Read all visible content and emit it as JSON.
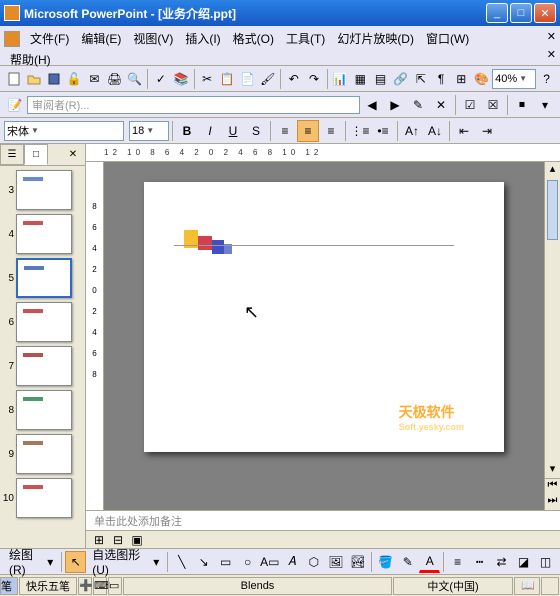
{
  "titlebar": {
    "title": "Microsoft PowerPoint - [业务介绍.ppt]"
  },
  "menu": {
    "file": "文件(F)",
    "edit": "编辑(E)",
    "view": "视图(V)",
    "insert": "插入(I)",
    "format": "格式(O)",
    "tools": "工具(T)",
    "slideshow": "幻灯片放映(D)",
    "window": "窗口(W)",
    "help": "帮助(H)"
  },
  "toolbar": {
    "zoom": "40%"
  },
  "review": {
    "reviewer_placeholder": "审阅者(R)..."
  },
  "format": {
    "font": "宋体",
    "size": "18",
    "bold": "B",
    "italic": "I",
    "underline": "U",
    "shadow": "S"
  },
  "thumbs": {
    "slides": [
      {
        "num": "3",
        "color": "#6a8ad0"
      },
      {
        "num": "4",
        "color": "#cc5252"
      },
      {
        "num": "5",
        "color": "#5a7ac0"
      },
      {
        "num": "6",
        "color": "#cc5252"
      },
      {
        "num": "7",
        "color": "#b05252"
      },
      {
        "num": "8",
        "color": "#4a9a6a"
      },
      {
        "num": "9",
        "color": "#a07a5a"
      },
      {
        "num": "10",
        "color": "#cc5252"
      }
    ],
    "selected": "5"
  },
  "ruler_h": "12 10 8 6 4 2 0 2 4 6 8 10 12",
  "ruler_v": [
    "8",
    "6",
    "4",
    "2",
    "0",
    "2",
    "4",
    "6",
    "8"
  ],
  "notes": {
    "placeholder": "单击此处添加备注"
  },
  "draw": {
    "menu": "绘图(R)",
    "autoshapes": "自选图形(U)"
  },
  "status": {
    "ime_label": "极品五笔",
    "ime1": "快乐五笔",
    "design": "Blends",
    "lang": "中文(中国)"
  },
  "watermark": {
    "line1": "天极软件",
    "line2": "Soft.yesky.com"
  }
}
